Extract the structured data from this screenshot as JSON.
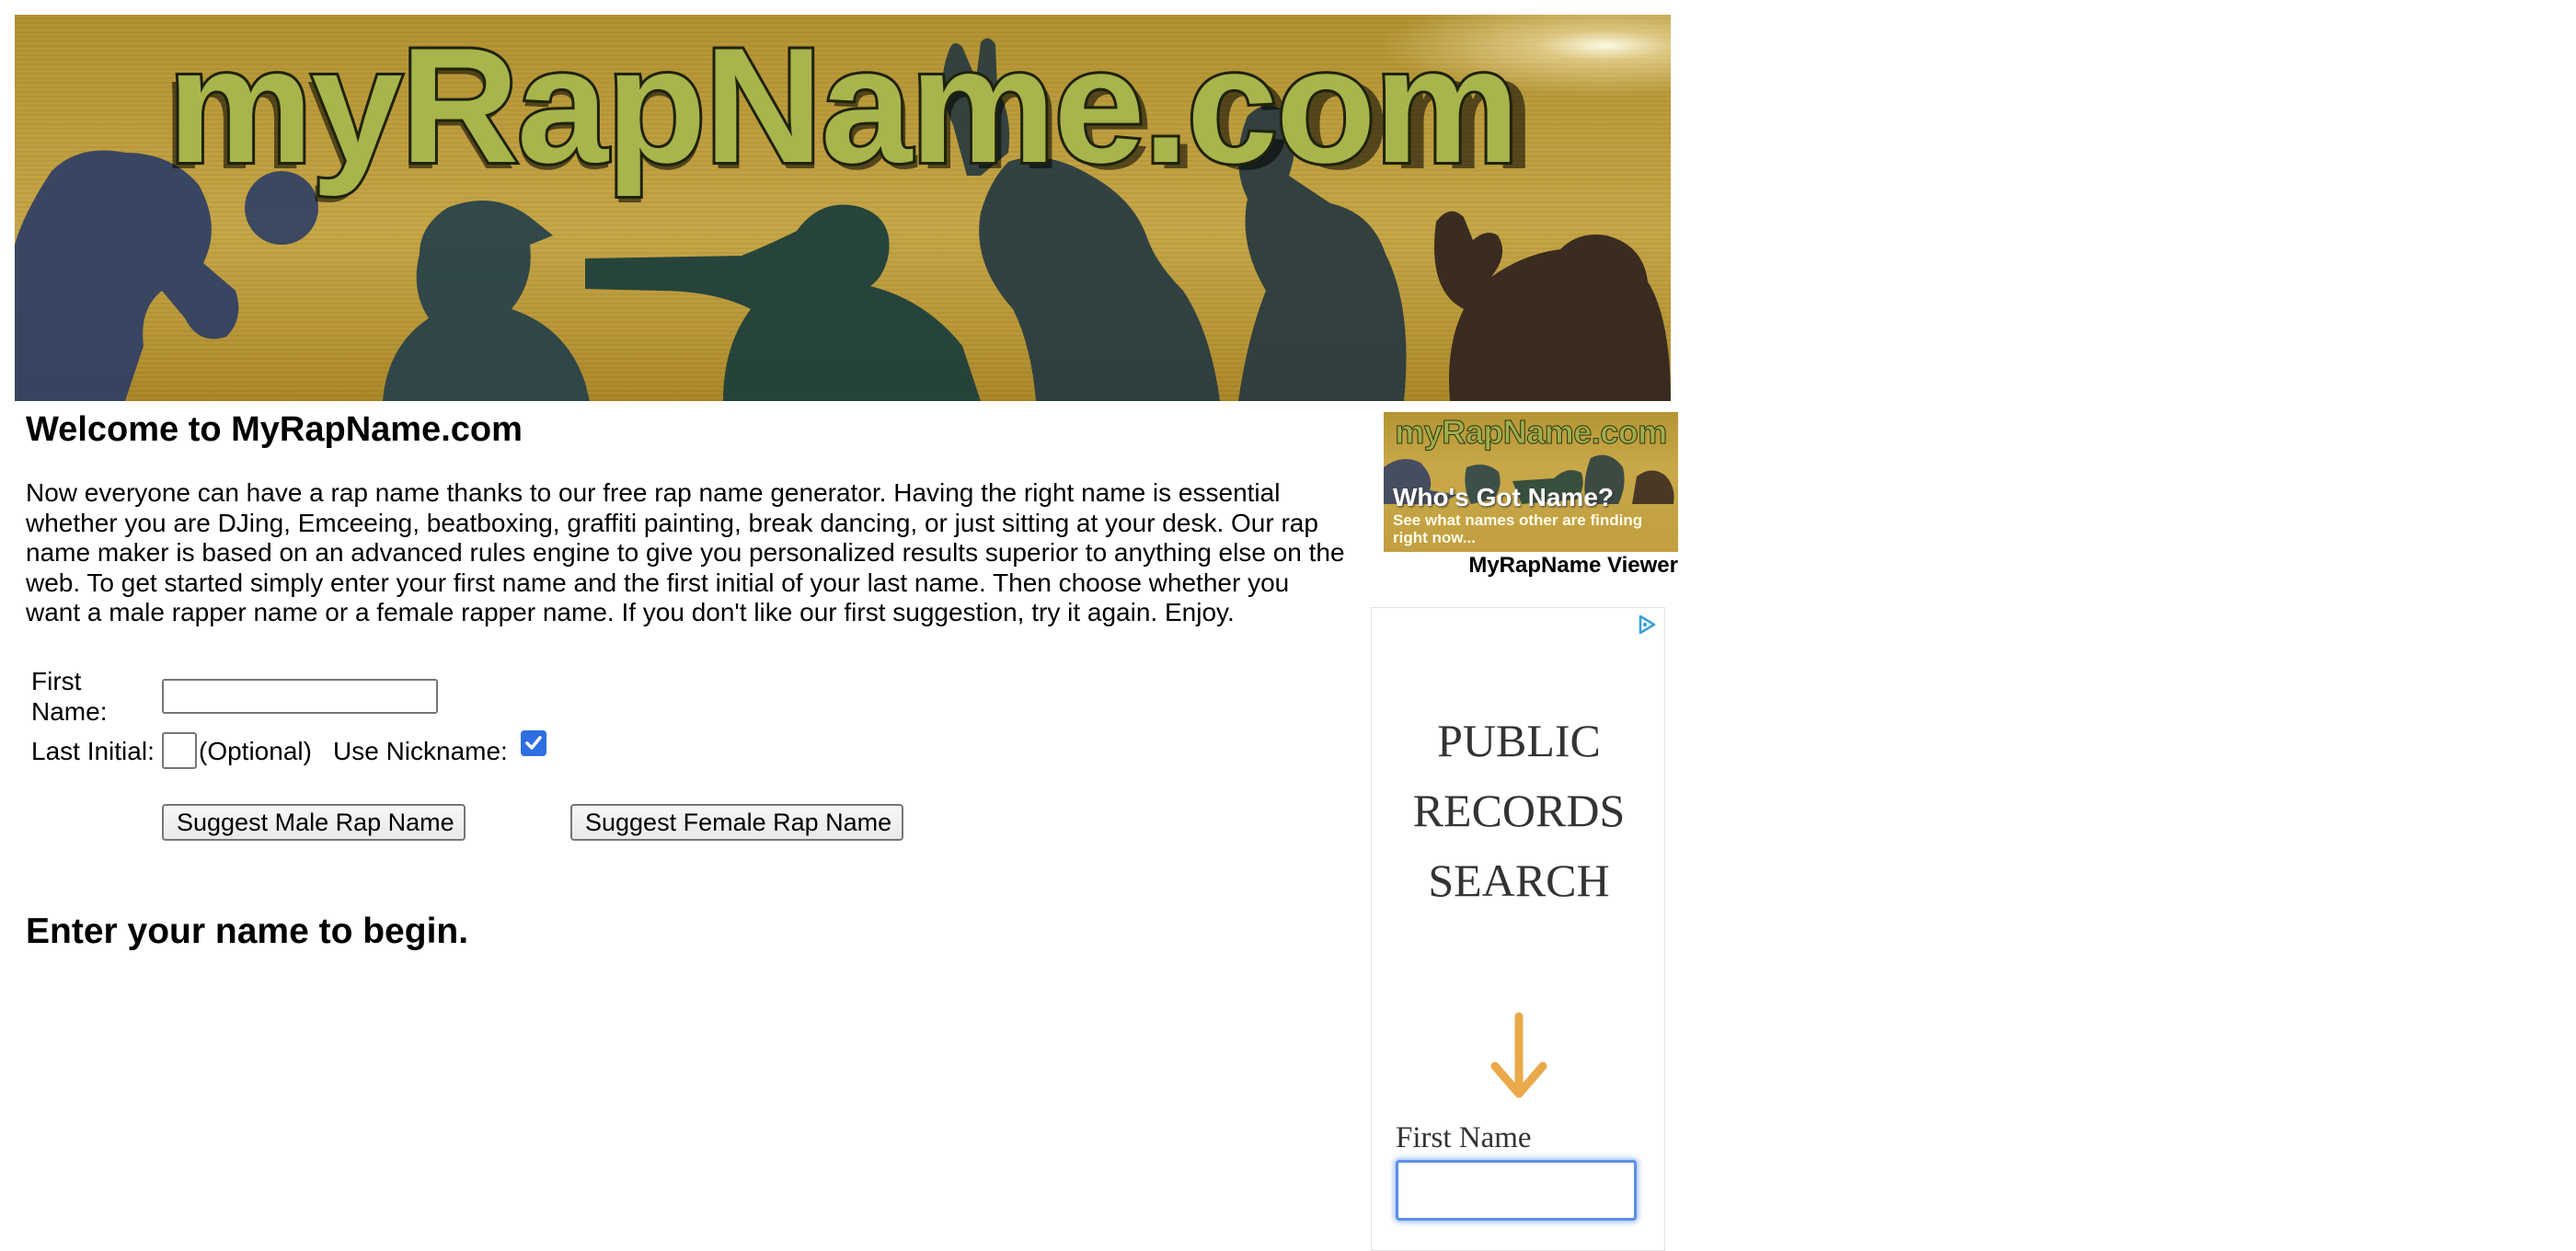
{
  "banner": {
    "logo_text": "myRapName.com"
  },
  "main": {
    "title": "Welcome to MyRapName.com",
    "intro": "Now everyone can have a rap name thanks to our free rap name generator. Having the right name is essential whether you are DJing, Emceeing, beatboxing, graffiti painting, break dancing, or just sitting at your desk. Our rap name maker is based on an advanced rules engine to give you personalized results superior to anything else on the web. To get started simply enter your first name and the first initial of your last name. Then choose whether you want a male rapper name or a female rapper name. If you don't like our first suggestion, try it again. Enjoy.",
    "status": "Enter your name to begin."
  },
  "form": {
    "first_name_label": "First Name:",
    "first_name_value": "",
    "last_initial_label": "Last Initial:",
    "last_initial_value": "",
    "optional_note": "(Optional)",
    "nickname_label": "Use Nickname:",
    "nickname_checked": true,
    "male_button": "Suggest Male Rap Name",
    "female_button": "Suggest Female Rap Name"
  },
  "sidebar": {
    "viewer_logo": "myRapName.com",
    "viewer_headline": "Who's Got Name?",
    "viewer_subtext": "See what names other are finding right now...",
    "viewer_caption": "MyRapName Viewer"
  },
  "ad": {
    "headline_line1": "PUBLIC",
    "headline_line2": "RECORDS",
    "headline_line3": "SEARCH",
    "field_label": "First Name",
    "field_value": "",
    "arrow_color": "#eaa94a",
    "adchoice_color": "#3ba0d8"
  },
  "colors": {
    "banner_gold": "#bd9b3b",
    "focus_blue": "#5b8fe8",
    "checkbox_blue": "#2d6fe0"
  }
}
